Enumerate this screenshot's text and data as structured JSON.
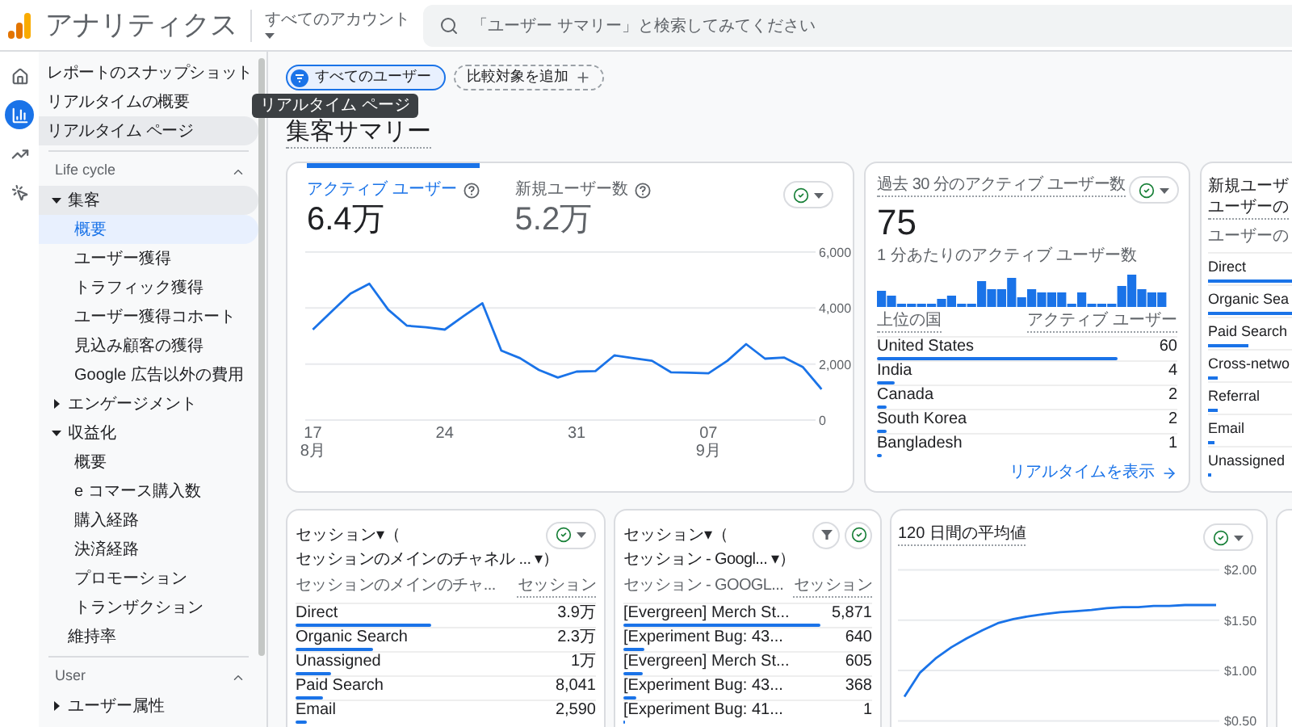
{
  "header": {
    "app_title": "アナリティクス",
    "account_label": "すべてのアカウント",
    "search": {
      "placeholder": "「ユーザー サマリー」と検索してみてください"
    }
  },
  "rail": [
    {
      "kind": "home",
      "selected": false
    },
    {
      "kind": "reports",
      "selected": true
    },
    {
      "kind": "explore",
      "selected": false
    },
    {
      "kind": "advertising",
      "selected": false
    }
  ],
  "sidebar": {
    "shortcuts": [
      {
        "label": "レポートのスナップショット",
        "selected": false,
        "hovered": false
      },
      {
        "label": "リアルタイムの概要",
        "selected": false,
        "hovered": false
      },
      {
        "label": "リアルタイム ページ",
        "selected": false,
        "hovered": true
      }
    ],
    "sections": [
      {
        "title": "Life cycle",
        "expanded": true,
        "items": [
          {
            "kind": "group",
            "label": "集客",
            "expanded": true,
            "selected": true,
            "children": [
              {
                "kind": "link",
                "label": "概要",
                "selected": true
              },
              {
                "kind": "link",
                "label": "ユーザー獲得",
                "selected": false
              },
              {
                "kind": "link",
                "label": "トラフィック獲得",
                "selected": false
              },
              {
                "kind": "link",
                "label": "ユーザー獲得コホート",
                "selected": false
              },
              {
                "kind": "link",
                "label": "見込み顧客の獲得",
                "selected": false
              },
              {
                "kind": "link",
                "label": "Google 広告以外の費用",
                "selected": false
              }
            ]
          },
          {
            "kind": "group",
            "label": "エンゲージメント",
            "expanded": false,
            "selected": false
          },
          {
            "kind": "group",
            "label": "収益化",
            "expanded": true,
            "selected": false,
            "children": [
              {
                "kind": "link",
                "label": "概要",
                "selected": false
              },
              {
                "kind": "link",
                "label": "e コマース購入数",
                "selected": false
              },
              {
                "kind": "link",
                "label": "購入経路",
                "selected": false
              },
              {
                "kind": "link",
                "label": "決済経路",
                "selected": false
              },
              {
                "kind": "link",
                "label": "プロモーション",
                "selected": false
              },
              {
                "kind": "link",
                "label": "トランザクション",
                "selected": false
              }
            ]
          },
          {
            "kind": "link",
            "label": "維持率",
            "selected": false
          }
        ]
      },
      {
        "title": "User",
        "expanded": true,
        "items": [
          {
            "kind": "group",
            "label": "ユーザー属性",
            "expanded": false,
            "selected": false
          }
        ]
      }
    ]
  },
  "tooltip": {
    "text": "リアルタイム ページ"
  },
  "filters": [
    {
      "kind": "segment",
      "label": "すべてのユーザー"
    },
    {
      "kind": "add",
      "label": "比較対象を追加"
    }
  ],
  "page_title": "集客サマリー",
  "overview_card": {
    "tabs": [
      {
        "label": "アクティブ ユーザー",
        "value": "6.4万",
        "selected": true
      },
      {
        "label": "新規ユーザー数",
        "value": "5.2万",
        "selected": false
      }
    ],
    "chart_data": {
      "type": "line",
      "x": [
        17,
        18,
        19,
        20,
        21,
        22,
        23,
        24,
        25,
        26,
        27,
        28,
        29,
        30,
        31,
        32,
        33,
        34,
        35,
        36,
        37,
        38,
        39,
        40,
        41,
        42,
        43,
        44
      ],
      "series": [
        {
          "color": "#1a73e8",
          "values": [
            3230,
            3880,
            4520,
            4870,
            3940,
            3370,
            3310,
            3230,
            3710,
            4170,
            2480,
            2210,
            1790,
            1520,
            1730,
            1750,
            2310,
            2210,
            2120,
            1710,
            1690,
            1670,
            2120,
            2710,
            2190,
            2230,
            1900,
            1100
          ]
        }
      ],
      "ylim": [
        0,
        6000
      ],
      "yticks": [
        {
          "value": 0,
          "label": "0"
        },
        {
          "value": 2000,
          "label": "2,000"
        },
        {
          "value": 4000,
          "label": "4,000"
        },
        {
          "value": 6000,
          "label": "6,000"
        }
      ],
      "xlim": [
        17,
        44
      ],
      "xticks": [
        {
          "value": 17,
          "label": "17\n8月"
        },
        {
          "value": 24,
          "label": "24"
        },
        {
          "value": 31,
          "label": "31"
        },
        {
          "value": 38,
          "label": "07\n9月"
        }
      ]
    }
  },
  "realtime_card": {
    "title": "過去 30 分のアクティブ ユーザー数",
    "value": "75",
    "subtitle": "1 分あたりのアクティブ ユーザー数",
    "columns": [
      "上位の国",
      "アクティブ ユーザー"
    ],
    "rows": [
      {
        "name": "United States",
        "value": "60",
        "level": 0.8
      },
      {
        "name": "India",
        "value": "4",
        "level": 0.06
      },
      {
        "name": "Canada",
        "value": "2",
        "level": 0.03
      },
      {
        "name": "South Korea",
        "value": "2",
        "level": 0.03
      },
      {
        "name": "Bangladesh",
        "value": "1",
        "level": 0.015
      }
    ],
    "link": "リアルタイムを表示"
  },
  "new_users_card": {
    "title_lines": [
      "新規ユーザ",
      "ユーザーの"
    ],
    "column": "ユーザーの",
    "rows": [
      {
        "name": "Direct",
        "level": 0.7
      },
      {
        "name": "Organic Sea",
        "level": 0.5
      },
      {
        "name": "Paid Search",
        "level": 0.13
      },
      {
        "name": "Cross-netwo",
        "level": 0.03
      },
      {
        "name": "Referral",
        "level": 0.03
      },
      {
        "name": "Email",
        "level": 0.02
      },
      {
        "name": "Unassigned",
        "level": 0.01
      }
    ]
  },
  "session_cards": [
    {
      "title_lines": [
        "セッション▾（",
        "セッションのメインのチャネル ... ▾）"
      ],
      "controls": [
        {
          "kind": "compare_menu"
        }
      ],
      "columns": [
        "セッションのメインのチャ...",
        "セッション"
      ],
      "rows": [
        {
          "name": "Direct",
          "value": "3.9万",
          "level": 0.45
        },
        {
          "name": "Organic Search",
          "value": "2.3万",
          "level": 0.26
        },
        {
          "name": "Unassigned",
          "value": "1万",
          "level": 0.12
        },
        {
          "name": "Paid Search",
          "value": "8,041",
          "level": 0.09
        },
        {
          "name": "Email",
          "value": "2,590",
          "level": 0.035
        }
      ]
    },
    {
      "title_lines": [
        "セッション▾（",
        "セッション - Googl... ▾）"
      ],
      "controls": [
        {
          "kind": "filter"
        },
        {
          "kind": "compare"
        }
      ],
      "columns": [
        "セッション - GOOGL...",
        "セッション"
      ],
      "rows": [
        {
          "name": "[Evergreen] Merch St...",
          "value": "5,871",
          "level": 0.79
        },
        {
          "name": "[Experiment Bug: 43...",
          "value": "640",
          "level": 0.085
        },
        {
          "name": "[Evergreen] Merch St...",
          "value": "605",
          "level": 0.08
        },
        {
          "name": "[Experiment Bug: 43...",
          "value": "368",
          "level": 0.05
        },
        {
          "name": "[Experiment Bug: 41...",
          "value": "1",
          "level": 0.003
        }
      ]
    }
  ],
  "average_card": {
    "title": "120 日間の平均値",
    "chart_data": {
      "type": "line",
      "series": [
        {
          "color": "#1a73e8",
          "values": [
            0.74,
            0.98,
            1.12,
            1.23,
            1.32,
            1.4,
            1.47,
            1.51,
            1.54,
            1.56,
            1.58,
            1.59,
            1.6,
            1.62,
            1.63,
            1.63,
            1.64,
            1.64,
            1.65,
            1.65,
            1.65
          ]
        }
      ],
      "ylim": [
        0.5,
        2
      ],
      "yticks": [
        {
          "value": 0.5,
          "label": "$0.50"
        },
        {
          "value": 1,
          "label": "$1.00"
        },
        {
          "value": 1.5,
          "label": "$1.50"
        },
        {
          "value": 2,
          "label": "$2.00"
        }
      ]
    }
  }
}
